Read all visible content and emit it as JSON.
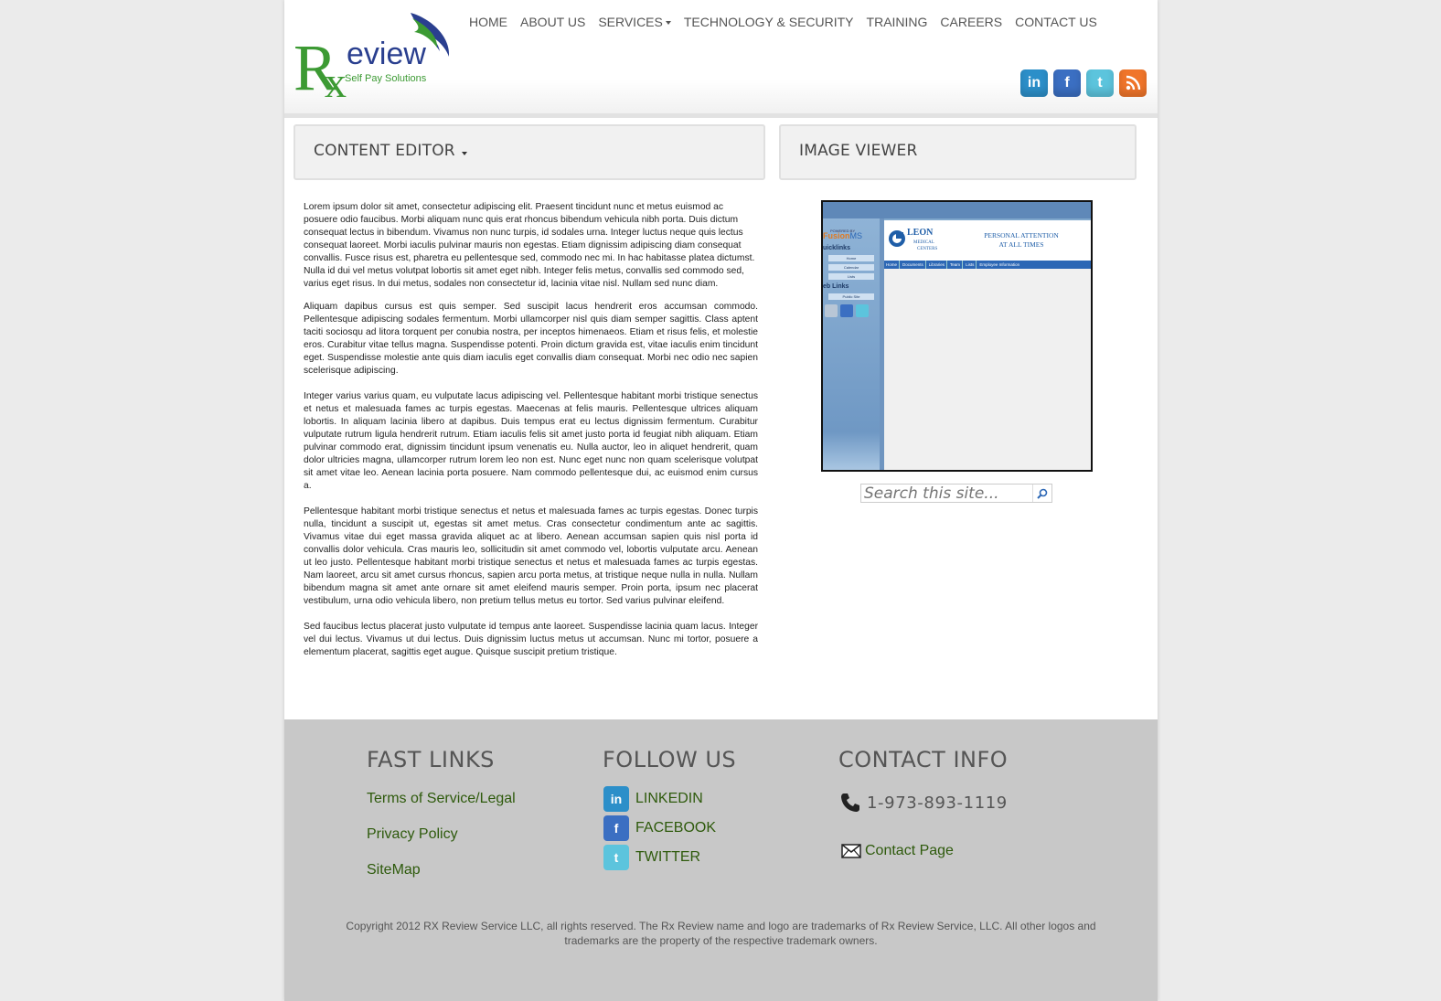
{
  "brand": {
    "logo_letters": "Rx",
    "logo_word": "eview",
    "tagline": "Self Pay Solutions",
    "colors": {
      "green": "#3c9a33",
      "blue": "#2a3f8f",
      "nav_text": "#555555",
      "link_green": "#2e5a0c",
      "footer_bg": "#c8c8c8"
    }
  },
  "nav": {
    "items": [
      {
        "label": "HOME"
      },
      {
        "label": "ABOUT US"
      },
      {
        "label": "SERVICES"
      },
      {
        "label": "TECHNOLOGY & SECURITY"
      },
      {
        "label": "TRAINING"
      },
      {
        "label": "CAREERS"
      },
      {
        "label": "CONTACT US"
      }
    ]
  },
  "header_social": [
    {
      "icon": "linkedin-icon",
      "glyph": "in"
    },
    {
      "icon": "facebook-icon",
      "glyph": "f"
    },
    {
      "icon": "twitter-icon",
      "glyph": "t"
    },
    {
      "icon": "rss-icon",
      "glyph": ""
    }
  ],
  "panels": {
    "content_editor": "CONTENT EDITOR",
    "image_viewer": "IMAGE VIEWER"
  },
  "content": {
    "paragraphs": [
      "Lorem ipsum dolor sit amet, consectetur adipiscing elit. Praesent tincidunt nunc et metus euismod ac posuere odio faucibus. Morbi aliquam nunc quis erat rhoncus bibendum vehicula nibh porta. Duis dictum consequat lectus in bibendum. Vivamus non nunc turpis, id sodales urna. Integer luctus neque quis lectus consequat laoreet. Morbi iaculis pulvinar mauris non egestas. Etiam dignissim adipiscing diam consequat convallis. Fusce risus est, pharetra eu pellentesque sed, commodo nec mi. In hac habitasse platea dictumst. Nulla id dui vel metus volutpat lobortis sit amet eget nibh. Integer felis metus, convallis sed commodo sed, varius eget risus. In dui metus, sodales non consectetur id, lacinia vitae nisl. Nullam sed nunc diam.",
      "Aliquam dapibus cursus est quis semper. Sed suscipit lacus hendrerit eros accumsan commodo. Pellentesque adipiscing sodales fermentum. Morbi ullamcorper nisl quis diam semper sagittis. Class aptent taciti sociosqu ad litora torquent per conubia nostra, per inceptos himenaeos. Etiam et risus felis, et molestie eros. Curabitur vitae tellus magna. Suspendisse potenti. Proin dictum gravida est, vitae iaculis enim tincidunt eget. Suspendisse molestie ante quis diam iaculis eget convallis diam consequat. Morbi nec odio nec sapien scelerisque adipiscing.",
      "Integer varius varius quam, eu vulputate lacus adipiscing vel. Pellentesque habitant morbi tristique senectus et netus et malesuada fames ac turpis egestas. Maecenas at felis mauris. Pellentesque ultrices aliquam lobortis. In aliquam lacinia libero at dapibus. Duis tempus erat eu lectus dignissim fermentum. Curabitur vulputate rutrum ligula hendrerit rutrum. Etiam iaculis felis sit amet justo porta id feugiat nibh aliquam. Etiam pulvinar commodo erat, dignissim tincidunt ipsum venenatis eu. Nulla auctor, leo in aliquet hendrerit, quam dolor ultricies magna, ullamcorper rutrum lorem leo non est. Nunc eget nunc non quam scelerisque volutpat sit amet vitae leo. Aenean lacinia porta posuere. Nam commodo pellentesque dui, ac euismod enim cursus a.",
      "Pellentesque habitant morbi tristique senectus et netus et malesuada fames ac turpis egestas. Donec turpis nulla, tincidunt a suscipit ut, egestas sit amet metus. Cras consectetur condimentum ante ac sagittis. Vivamus vitae dui eget massa gravida aliquet ac at libero. Aenean accumsan sapien quis nisl porta id convallis dolor vehicula. Cras mauris leo, sollicitudin sit amet commodo vel, lobortis vulputate arcu. Aenean ut leo justo. Pellentesque habitant morbi tristique senectus et netus et malesuada fames ac turpis egestas. Nam laoreet, arcu sit amet cursus rhoncus, sapien arcu porta metus, at tristique neque nulla in nulla. Nullam bibendum magna sit amet ante ornare sit amet eleifend mauris semper. Proin porta, ipsum nec placerat vestibulum, urna odio vehicula libero, non pretium tellus metus eu tortor. Sed varius pulvinar eleifend.",
      "Sed faucibus lectus placerat justo vulputate id tempus ante laoreet. Suspendisse lacinia quam lacus. Integer vel dui lectus. Vivamus ut dui lectus. Duis dignissim luctus metus ut accumsan. Nunc mi tortor, posuere a elementum placerat, sagittis eget augue. Quisque suscipit pretium tristique."
    ]
  },
  "viewer": {
    "powered_by": "POWERED BY",
    "fusion": "Fusion",
    "ms": "MS",
    "quicklinks": "uicklinks",
    "quicklink_items": [
      "Home",
      "Calendar",
      "Lists"
    ],
    "weblinks": "eb Links",
    "weblink_items": [
      "Public Site"
    ],
    "leon_title": "LEON",
    "leon_sub1": "MEDICAL",
    "leon_sub2": "CENTERS",
    "slogan1": "PERSONAL ATTENTION",
    "slogan2": "AT ALL TIMES",
    "tabs": [
      "Home",
      "Documents",
      "Libraries",
      "Team",
      "Lists",
      "Employee Information"
    ]
  },
  "search": {
    "placeholder": "Search this site..."
  },
  "footer": {
    "fast_links_title": "FAST LINKS",
    "fast_links": [
      "Terms of Service/Legal",
      "Privacy Policy",
      "SiteMap"
    ],
    "follow_title": "FOLLOW US",
    "follow": [
      {
        "label": "LINKEDIN",
        "icon": "linkedin-icon",
        "glyph": "in"
      },
      {
        "label": "FACEBOOK",
        "icon": "facebook-icon",
        "glyph": "f"
      },
      {
        "label": "TWITTER",
        "icon": "twitter-icon",
        "glyph": "t"
      }
    ],
    "contact_title": "CONTACT INFO",
    "phone": "1-973-893-1119",
    "contact_page": "Contact Page",
    "copyright_line1": "Copyright 2012 RX Review Service LLC, all rights reserved. The Rx Review name and logo are trademarks of Rx Review Service, LLC. All other logos and",
    "copyright_line2": "trademarks are the property of the respective trademark owners."
  }
}
